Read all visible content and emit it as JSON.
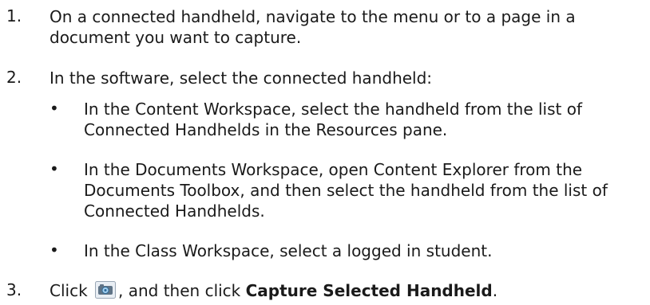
{
  "steps": [
    {
      "number": "1.",
      "text": "On a connected handheld, navigate to the menu or to a page in a document you want to capture."
    },
    {
      "number": "2.",
      "text": "In the software, select the connected handheld:",
      "bullets": [
        "In the Content Workspace, select the handheld from the list of Connected Handhelds in the Resources pane.",
        "In the Documents Workspace, open Content Explorer from the Documents Toolbox, and then select the handheld from the list of Connected Handhelds.",
        "In the Class Workspace, select a logged in student."
      ]
    },
    {
      "number": "3.",
      "before": "Click",
      "icon": "camera-icon",
      "middle": ", and then click",
      "bold": "Capture Selected Handheld",
      "end": "."
    }
  ],
  "bullet_char": "•"
}
